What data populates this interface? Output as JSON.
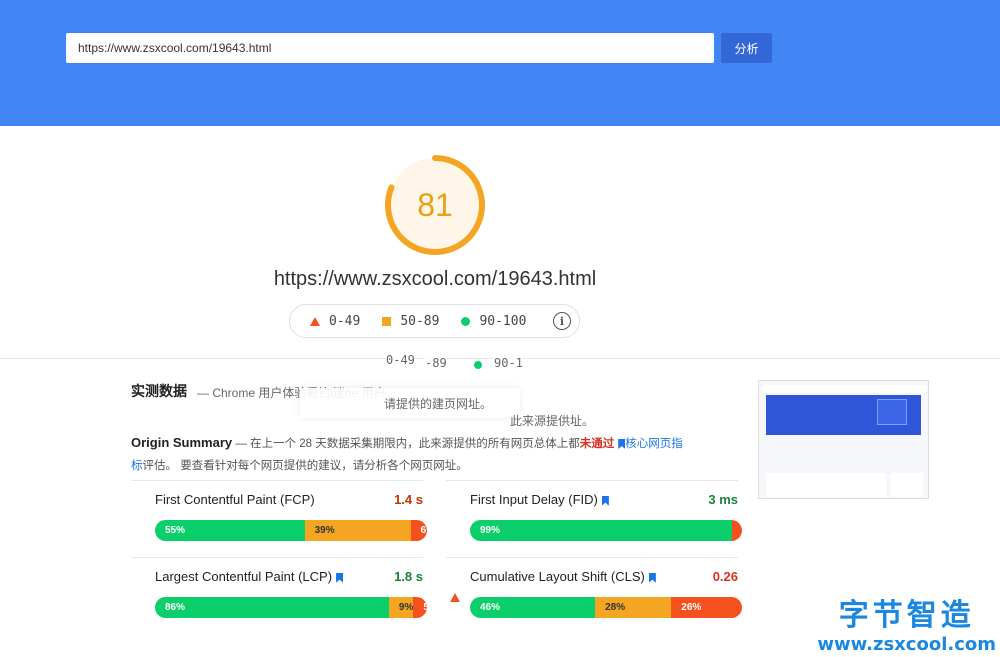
{
  "search": {
    "url_value": "https://www.zsxcool.com/19643.html",
    "analyze_label": "分析"
  },
  "score": {
    "value": "81",
    "fraction": 0.81,
    "color": "#f4a522"
  },
  "page_url": "https://www.zsxcool.com/19643.html",
  "legend": {
    "items": [
      "0-49",
      "50-89",
      "90-100"
    ],
    "info_icon": "i"
  },
  "ghost": {
    "r1a": "0-49",
    "r1b": "-89",
    "r1c": "90-1",
    "tip1": "请提供的建页网址。",
    "tip2": "此来源提供址。"
  },
  "field": {
    "title": "实测数据",
    "subtitle": "— Chrome 用户体验看钓i迷he 用户"
  },
  "origin": {
    "title": "Origin Summary",
    "desc_part1": "— 在上一个 28 天数据采集期限内，此来源提供的所有网页总体上都",
    "desc_fail": "未通过",
    "desc_link": "核心网页指标",
    "desc_part2": "评估。 要查看针对每个网页提供的建议，请分析各个网页网址。"
  },
  "metrics": [
    {
      "name": "First Contentful Paint (FCP)",
      "value": "1.4 s",
      "status": "average",
      "bookmark": false,
      "segments": [
        "55%",
        "39%",
        "6%"
      ],
      "fractions": [
        0.55,
        0.39,
        0.06
      ]
    },
    {
      "name": "First Input Delay (FID)",
      "value": "3 ms",
      "status": "good",
      "bookmark": true,
      "segments": [
        "99%",
        "",
        "1%"
      ],
      "fractions": [
        0.99,
        0,
        0.01
      ]
    },
    {
      "name": "Largest Contentful Paint (LCP)",
      "value": "1.8 s",
      "status": "good",
      "bookmark": true,
      "segments": [
        "86%",
        "9%",
        "5%"
      ],
      "fractions": [
        0.86,
        0.09,
        0.05
      ]
    },
    {
      "name": "Cumulative Layout Shift (CLS)",
      "value": "0.26",
      "status": "poor",
      "bookmark": true,
      "segments": [
        "46%",
        "28%",
        "26%"
      ],
      "fractions": [
        0.46,
        0.28,
        0.26
      ]
    }
  ],
  "colors": {
    "header": "#4285f4",
    "good": "#0cce6b",
    "average": "#f4a522",
    "poor": "#f4511e",
    "value_good": "#178239",
    "value_avg": "#c33300"
  },
  "watermark": {
    "cn": "字节智造",
    "en": "www.zsxcool.com"
  }
}
